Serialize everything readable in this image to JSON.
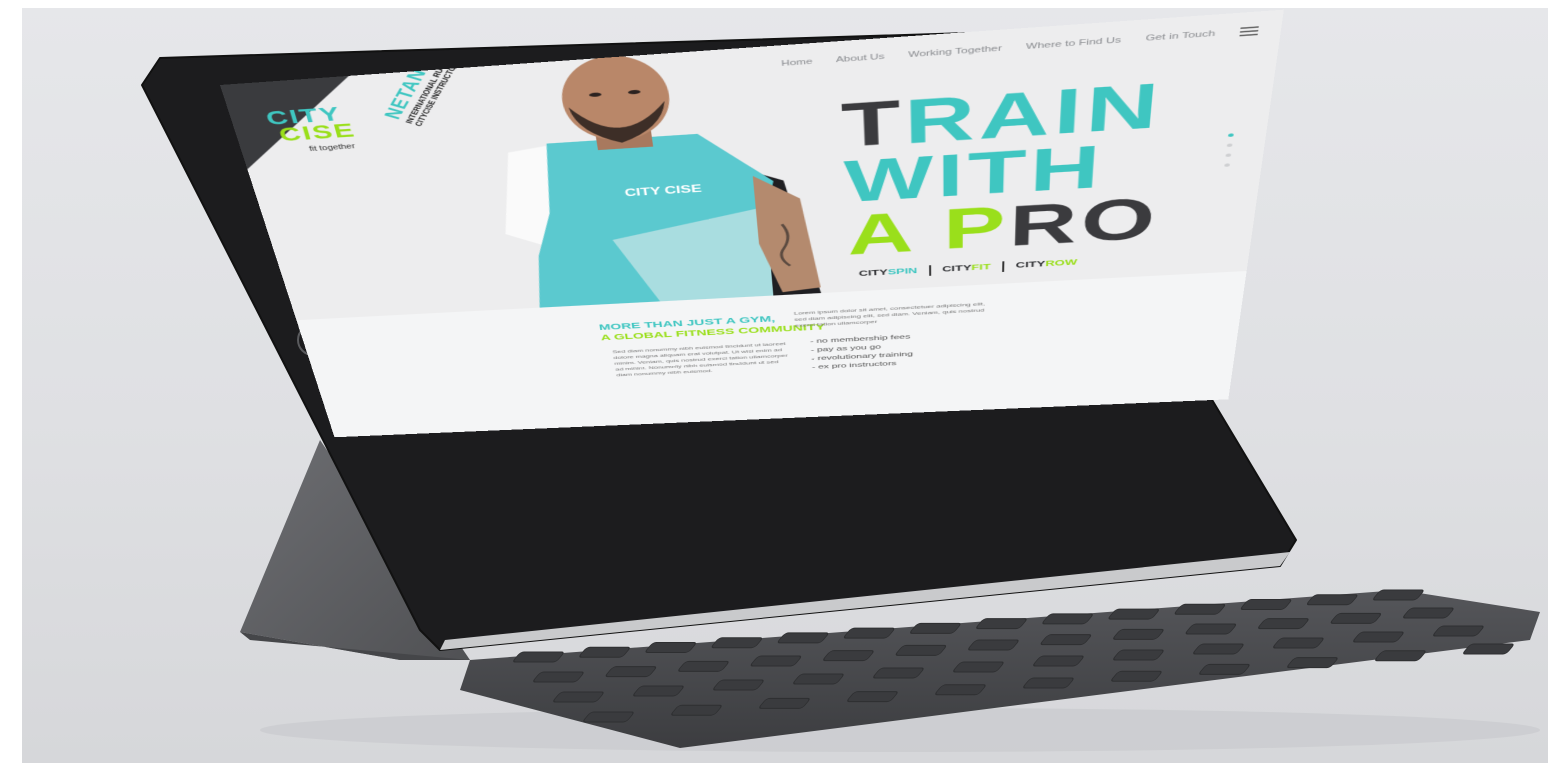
{
  "colors": {
    "teal": "#3fc6c1",
    "lime": "#9adf1b",
    "dark": "#3b3b3e",
    "device": "#1c1c1e",
    "keyboard": "#4a4b4e"
  },
  "logo": {
    "line1": "CITY",
    "line2": "CISE",
    "tagline": "fit together"
  },
  "nav": {
    "items": [
      "Home",
      "About Us",
      "Working Together",
      "Where to Find Us",
      "Get in Touch"
    ],
    "menu_icon": "hamburger-icon"
  },
  "featured": {
    "name": "NETANI TALEI",
    "role_line1": "INTERNATIONAL RUGBY PLAYER",
    "role_line2": "CITYCISE INSTRUCTOR",
    "shirt_logo": "CITY CISE"
  },
  "headline": {
    "line1_dark": "T",
    "line1_teal": "RAIN",
    "line2": "WITH",
    "line3_a": "A P",
    "line3_dark": "RO"
  },
  "brands": {
    "spin_prefix": "CITY",
    "spin_suffix": "SPIN",
    "fit_prefix": "CITY",
    "fit_suffix": "FIT",
    "row_prefix": "CITY",
    "row_suffix": "ROW"
  },
  "carousel": {
    "count": 4,
    "active": 1
  },
  "content": {
    "tagline_line1": "MORE THAN JUST A GYM,",
    "tagline_line2": "A GLOBAL FITNESS COMMUNITY",
    "lorem_right": "Lorem ipsum dolor sit amet, consectetuer adipiscing elit, sed diam adipiscing elit, sed diam. Veniam, quis nostrud exerci tation ullamcorper",
    "lorem_left": "Sed diam nonummy nibh euismod tincidunt ut laoreet dolore magna aliquam erat volutpat. Ut wisi enim ad minim. Veniam, quis nostrud exerci tation ullamcorper ad minim. Nonummy nibh euismod tincidunt ut sed diam nonummy nibh euismod.",
    "bullets": [
      "- no membership fees",
      "- pay as you go",
      "- revolutionary training",
      "- ex pro instructors"
    ]
  }
}
